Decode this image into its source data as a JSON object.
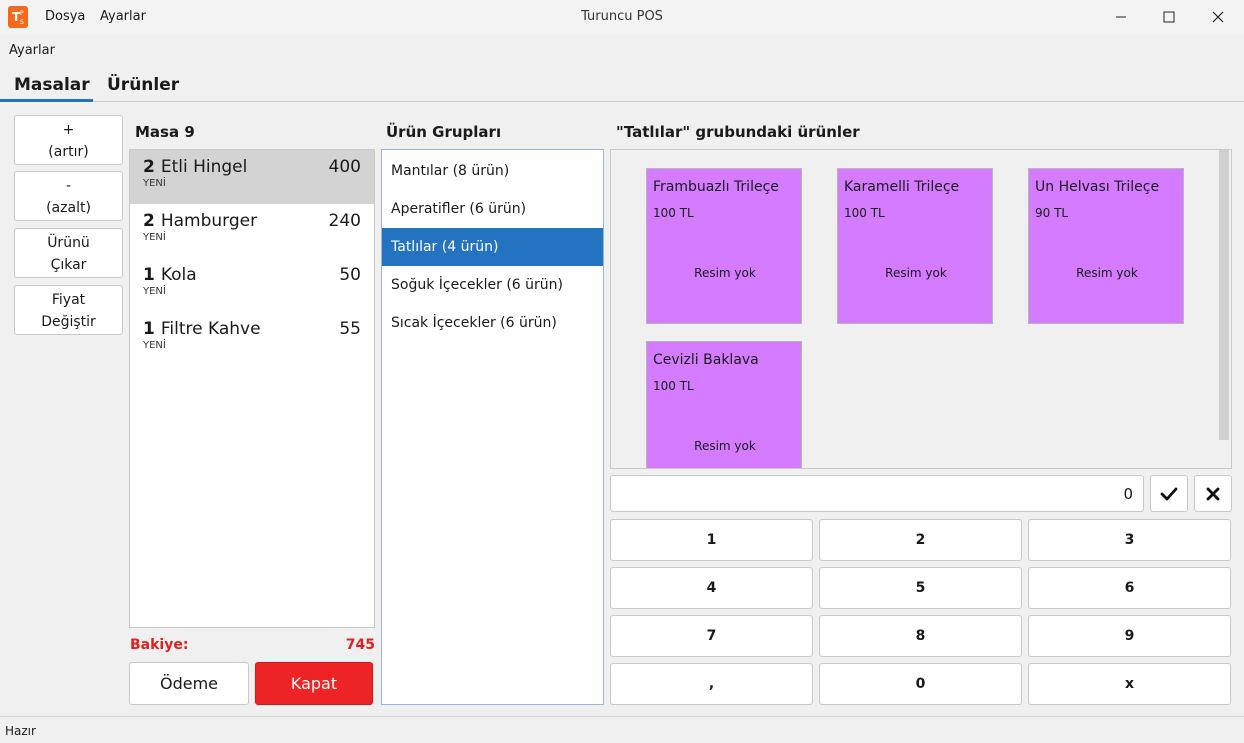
{
  "window": {
    "title": "Turuncu POS",
    "menu": [
      "Dosya",
      "Ayarlar"
    ],
    "logo_letters": "TPS"
  },
  "toolbar": {
    "ayarlar": "Ayarlar"
  },
  "tabs": [
    "Masalar",
    "Ürünler"
  ],
  "side_buttons": [
    [
      "+",
      "(artır)"
    ],
    [
      "-",
      "(azalt)"
    ],
    [
      "Ürünü",
      "Çıkar"
    ],
    [
      "Fiyat",
      "Değiştir"
    ]
  ],
  "table": {
    "title": "Masa 9",
    "orders": [
      {
        "qty": "2",
        "name": "Etli Hingel",
        "price": "400",
        "status": "YENİ"
      },
      {
        "qty": "2",
        "name": "Hamburger",
        "price": "240",
        "status": "YENİ"
      },
      {
        "qty": "1",
        "name": "Kola",
        "price": "50",
        "status": "YENİ"
      },
      {
        "qty": "1",
        "name": "Filtre Kahve",
        "price": "55",
        "status": "YENİ"
      }
    ],
    "balance_label": "Bakiye:",
    "balance_value": "745",
    "pay_label": "Ödeme",
    "close_label": "Kapat"
  },
  "groups": {
    "title": "Ürün Grupları",
    "items": [
      "Mantılar (8 ürün)",
      "Aperatifler (6 ürün)",
      "Tatlılar (4 ürün)",
      "Soğuk İçecekler (6 ürün)",
      "Sıcak İçecekler (6 ürün)"
    ]
  },
  "products": {
    "title": "\"Tatlılar\" grubundaki ürünler",
    "items": [
      {
        "name": "Frambuazlı Trileçe",
        "price": "100 TL",
        "image": "Resim yok"
      },
      {
        "name": "Karamelli Trileçe",
        "price": "100 TL",
        "image": "Resim yok"
      },
      {
        "name": "Un Helvası Trileçe",
        "price": "90 TL",
        "image": "Resim yok"
      },
      {
        "name": "Cevizli Baklava",
        "price": "100 TL",
        "image": "Resim yok"
      }
    ]
  },
  "numpad": {
    "value": "0",
    "keys": [
      "1",
      "2",
      "3",
      "4",
      "5",
      "6",
      "7",
      "8",
      "9",
      ",",
      "0",
      "x"
    ]
  },
  "status": "Hazır",
  "colors": {
    "accent": "#2473c0",
    "danger": "#ee2326",
    "card": "#d47bff"
  }
}
